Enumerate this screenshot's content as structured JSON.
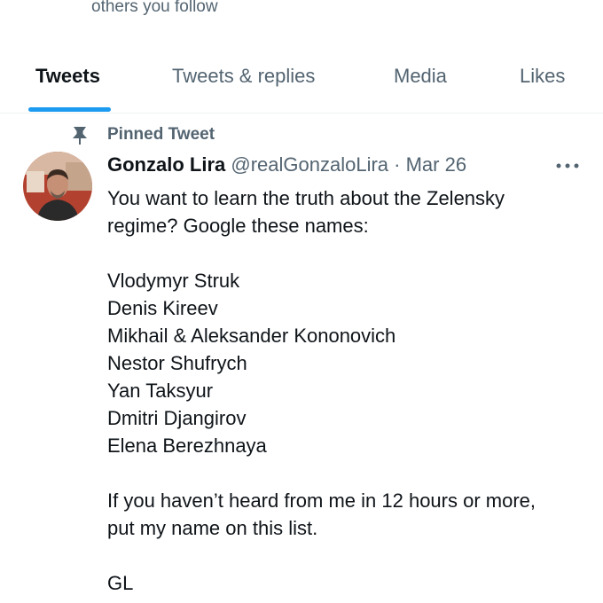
{
  "header_snippet": "others you follow",
  "tabs": [
    {
      "label": "Tweets",
      "active": true
    },
    {
      "label": "Tweets & replies",
      "active": false
    },
    {
      "label": "Media",
      "active": false
    },
    {
      "label": "Likes",
      "active": false
    }
  ],
  "pinned": {
    "icon": "pin-icon",
    "label": "Pinned Tweet"
  },
  "tweet": {
    "avatar_icon": "avatar",
    "author_name": "Gonzalo Lira",
    "handle": "@realGonzaloLira",
    "separator": "·",
    "date": "Mar 26",
    "more_icon": "more-icon",
    "lines": [
      "You want to learn the truth about the Zelensky",
      "regime? Google these names:",
      "Vlodymyr Struk",
      "Denis Kireev",
      "Mikhail & Aleksander Kononovich",
      "Nestor Shufrych",
      "Yan Taksyur",
      "Dmitri Djangirov",
      "Elena Berezhnaya",
      "If you haven’t heard from me in 12 hours or more,",
      "put my name on this list.",
      "GL"
    ]
  },
  "colors": {
    "accent": "#1d9bf0",
    "secondary_text": "#536471",
    "primary_text": "#0f1419"
  }
}
